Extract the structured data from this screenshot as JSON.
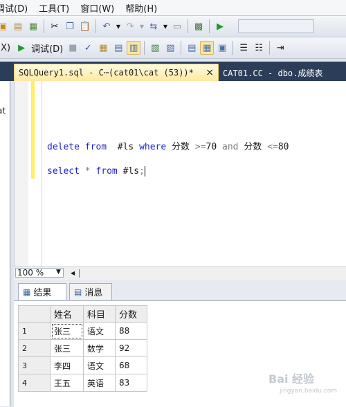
{
  "menu": [
    "调试(D)",
    "工具(T)",
    "窗口(W)",
    "帮助(H)"
  ],
  "toolbar2": {
    "left_label": "(X)",
    "debug_label": "调试(D)"
  },
  "tabs": {
    "active": "SQLQuery1.sql - C⋯(cat01\\cat (53))*",
    "active_close": "×",
    "inactive": "CAT01.CC - dbo.成绩表"
  },
  "left_panel_text": "at",
  "editor": {
    "line1": {
      "kw1": "delete",
      "kw2": "from",
      "table": "#ls",
      "kw3": "where",
      "col1": "分数",
      "op1": ">=",
      "v1": "70",
      "kw4": "and",
      "col2": "分数",
      "op2": "<=",
      "v2": "80"
    },
    "line2": {
      "kw1": "select",
      "star": "*",
      "kw2": "from",
      "table": "#ls",
      "semi": ";"
    }
  },
  "zoom": "100 %",
  "results_tabs": {
    "results": "结果",
    "messages": "消息"
  },
  "grid": {
    "headers": [
      "姓名",
      "科目",
      "分数"
    ],
    "rows": [
      {
        "n": "1",
        "name": "张三",
        "subject": "语文",
        "score": "88"
      },
      {
        "n": "2",
        "name": "张三",
        "subject": "数学",
        "score": "92"
      },
      {
        "n": "3",
        "name": "李四",
        "subject": "语文",
        "score": "68"
      },
      {
        "n": "4",
        "name": "王五",
        "subject": "英语",
        "score": "83"
      }
    ]
  },
  "watermark": {
    "main": "Bai 经验",
    "sub": "jingyan.baidu.com"
  },
  "colors": {
    "keyword": "#1d24c7",
    "tab_active": "#fde9a0",
    "tabstrip": "#2b3d59",
    "change_bar": "#ffee62"
  }
}
